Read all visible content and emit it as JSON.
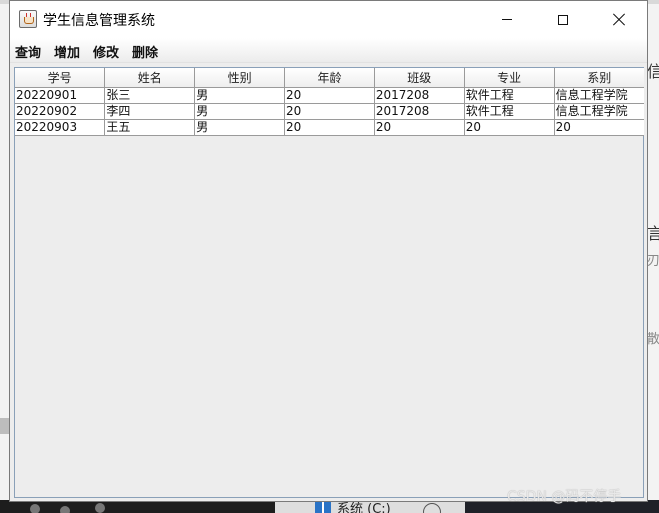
{
  "window": {
    "title": "学生信息管理系统",
    "controls": {
      "minimize": "minimize",
      "maximize": "maximize",
      "close": "close"
    }
  },
  "menu": {
    "items": [
      "查询",
      "增加",
      "修改",
      "删除"
    ]
  },
  "table": {
    "columns": [
      "学号",
      "姓名",
      "性别",
      "年龄",
      "班级",
      "专业",
      "系别"
    ],
    "rows": [
      [
        "20220901",
        "张三",
        "男",
        "20",
        "2017208",
        "软件工程",
        "信息工程学院"
      ],
      [
        "20220902",
        "李四",
        "男",
        "20",
        "2017208",
        "软件工程",
        "信息工程学院"
      ],
      [
        "20220903",
        "王五",
        "男",
        "20",
        "20",
        "20",
        "20"
      ]
    ]
  },
  "background": {
    "right_glyphs": [
      "信",
      "言",
      "刃",
      "散"
    ],
    "taskbar_label": "系统 (C:)"
  },
  "watermark": "CSDN @码不停手",
  "colors": {
    "window_bg": "#ededed",
    "titlebar_bg": "#ffffff",
    "table_border": "#8aa0b8",
    "grid_line": "#9a9a9a"
  }
}
